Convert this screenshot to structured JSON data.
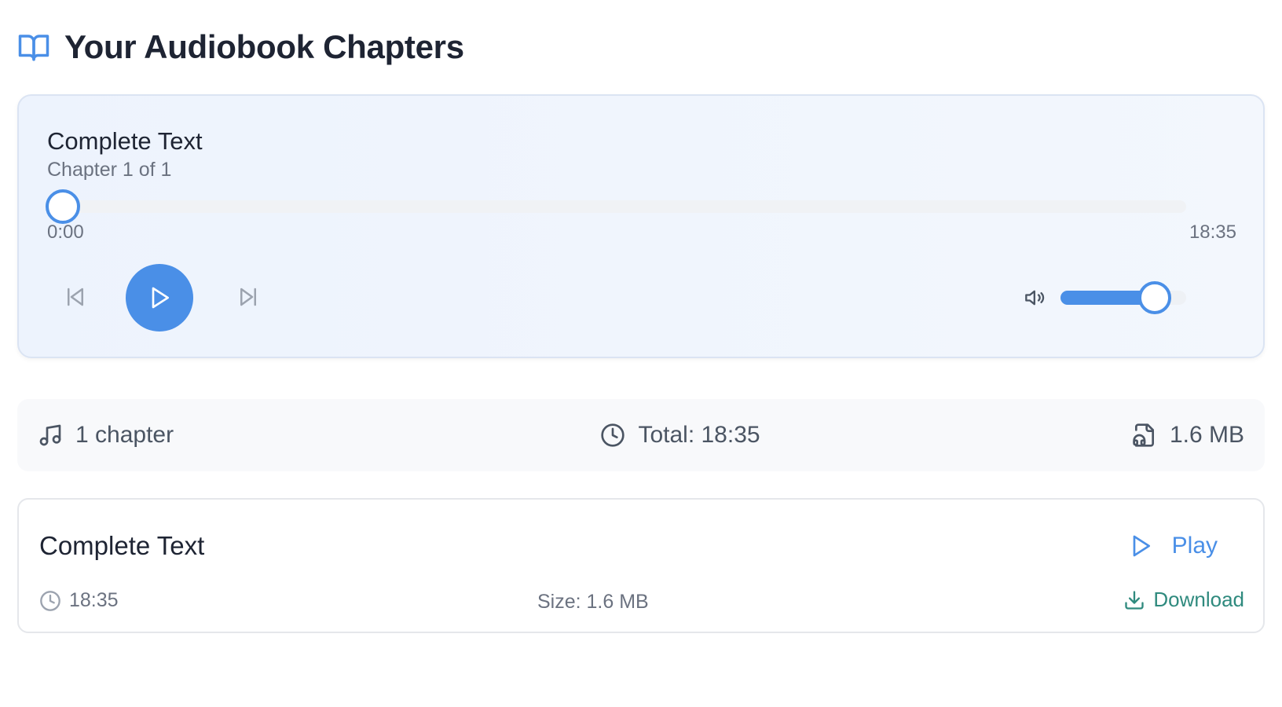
{
  "header": {
    "title": "Your Audiobook Chapters",
    "icon": "book-open-icon"
  },
  "player": {
    "title": "Complete Text",
    "subtitle": "Chapter 1 of 1",
    "progress": 0,
    "time_current": "0:00",
    "time_total": "18:35",
    "volume": 0.75,
    "icons": {
      "prev": "skip-back-icon",
      "play": "play-icon",
      "next": "skip-forward-icon",
      "volume": "volume-icon"
    }
  },
  "stats": {
    "chapters": "1 chapter",
    "total": "Total: 18:35",
    "size": "1.6 MB"
  },
  "chapters": [
    {
      "title": "Complete Text",
      "duration": "18:35",
      "size": "Size: 1.6 MB",
      "play_label": "Play",
      "download_label": "Download"
    }
  ],
  "colors": {
    "accent": "#4a8fe7",
    "download": "#2f8a7e"
  }
}
